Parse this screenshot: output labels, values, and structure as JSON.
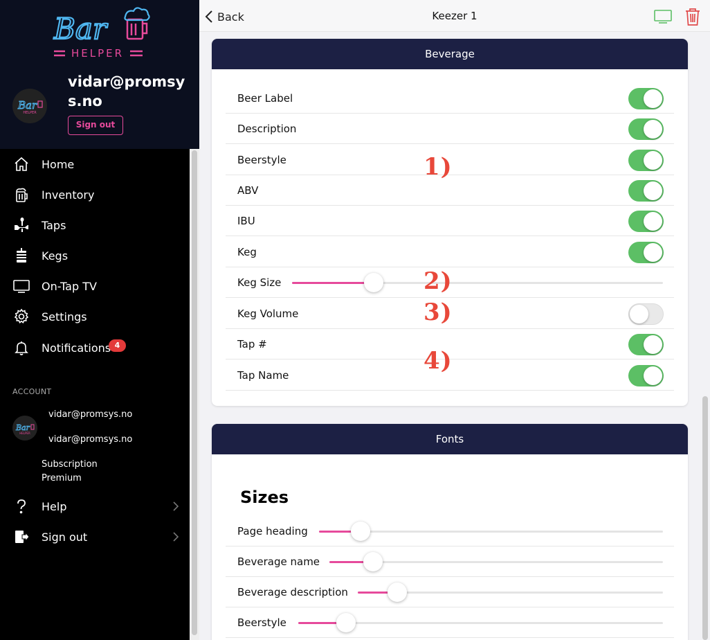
{
  "app": {
    "logo_text": "Bar",
    "logo_sub": "HELPER",
    "colors": {
      "sidebar_bg": "#000000",
      "header_bg": "#0b0f1f",
      "accent_pink": "#e64a9b",
      "logo_blue": "#4fb6f0",
      "card_header": "#1c2044",
      "toggle_on": "#5cbf65",
      "annotation_red": "#e8483a",
      "tv_green": "#5cbf65",
      "trash_red": "#e04a4a"
    }
  },
  "sidebar": {
    "user_email": "vidar@promsys.no",
    "signout_button": "Sign out",
    "nav": [
      {
        "label": "Home",
        "icon": "home-icon"
      },
      {
        "label": "Inventory",
        "icon": "beer-mug-icon"
      },
      {
        "label": "Taps",
        "icon": "tap-icon"
      },
      {
        "label": "Kegs",
        "icon": "keg-icon"
      },
      {
        "label": "On-Tap TV",
        "icon": "tv-icon"
      },
      {
        "label": "Settings",
        "icon": "gear-icon"
      },
      {
        "label": "Notifications",
        "icon": "bell-icon",
        "badge": "4"
      }
    ],
    "account": {
      "title": "ACCOUNT",
      "email_1": "vidar@promsys.no",
      "email_2": "vidar@promsys.no",
      "subscription_line1": "Subscription",
      "subscription_line2": "Premium"
    },
    "footer": [
      {
        "label": "Help",
        "icon": "question-icon"
      },
      {
        "label": "Sign out",
        "icon": "signout-icon"
      }
    ]
  },
  "topbar": {
    "back_label": "Back",
    "title": "Keezer 1",
    "tv_icon": "tv-icon",
    "trash_icon": "trash-icon"
  },
  "beverage": {
    "header": "Beverage",
    "rows": [
      {
        "label": "Beer Label",
        "type": "toggle",
        "on": true
      },
      {
        "label": "Description",
        "type": "toggle",
        "on": true
      },
      {
        "label": "Beerstyle",
        "type": "toggle",
        "on": true
      },
      {
        "label": "ABV",
        "type": "toggle",
        "on": true
      },
      {
        "label": "IBU",
        "type": "toggle",
        "on": true
      },
      {
        "label": "Keg",
        "type": "toggle",
        "on": true
      },
      {
        "label": "Keg Size",
        "type": "slider",
        "value": 0.22
      },
      {
        "label": "Keg Volume",
        "type": "toggle",
        "on": false
      },
      {
        "label": "Tap #",
        "type": "toggle",
        "on": true
      },
      {
        "label": "Tap Name",
        "type": "toggle",
        "on": true
      }
    ],
    "annotations": [
      "1)",
      "2)",
      "3)",
      "4)"
    ]
  },
  "fonts": {
    "header": "Fonts",
    "sizes_title": "Sizes",
    "rows": [
      {
        "label": "Page heading",
        "value": 0.12
      },
      {
        "label": "Beverage name",
        "value": 0.13
      },
      {
        "label": "Beverage description",
        "value": 0.13
      },
      {
        "label": "Beerstyle",
        "value": 0.13
      }
    ]
  }
}
